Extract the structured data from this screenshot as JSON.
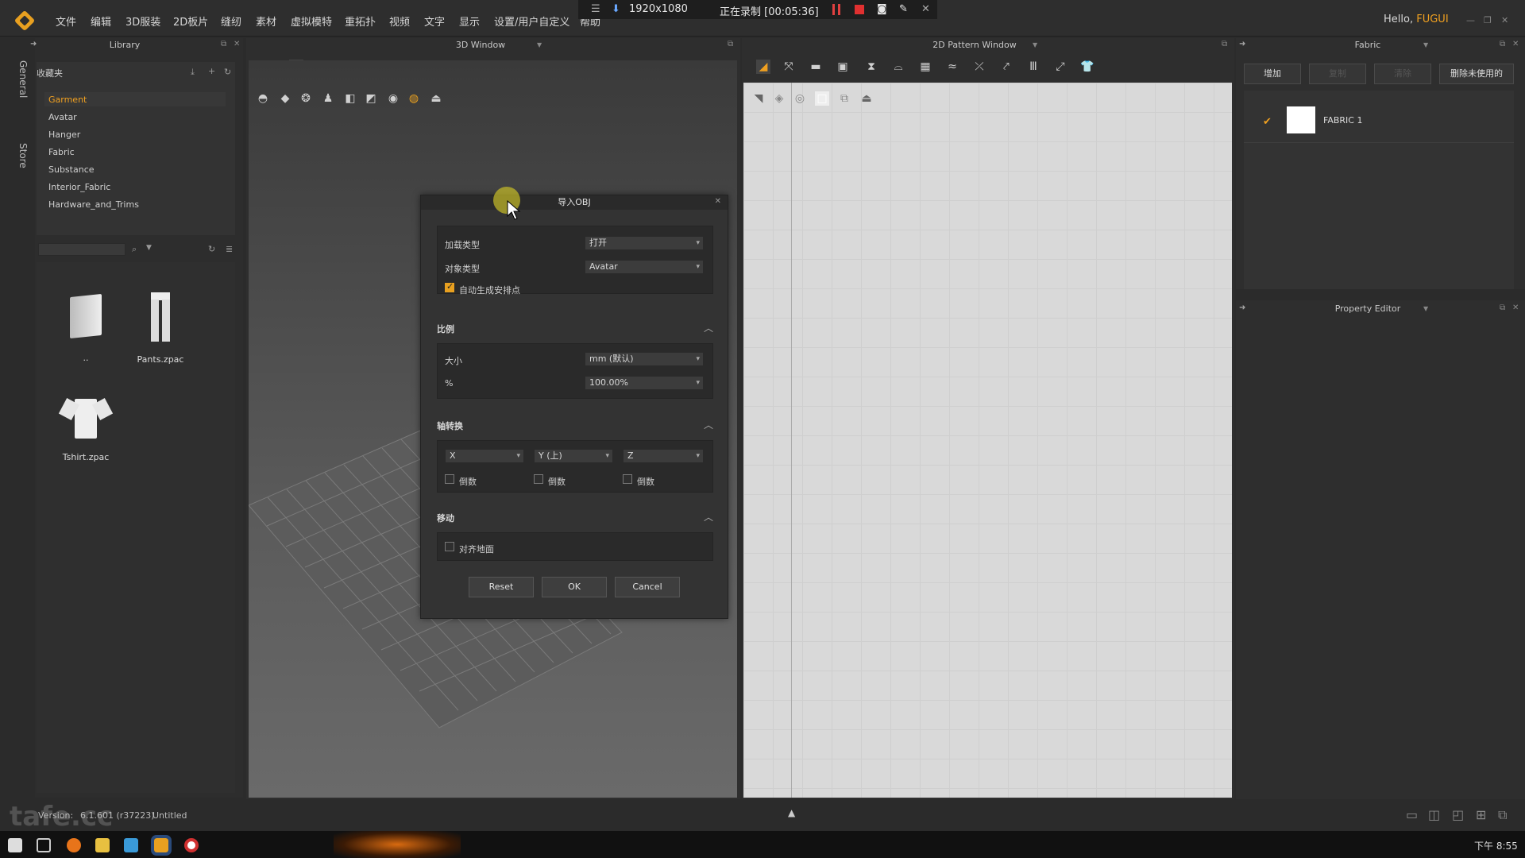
{
  "menubar": {
    "items": [
      "文件",
      "编辑",
      "3D服装",
      "2D板片",
      "缝纫",
      "素材",
      "虚拟模特",
      "重拓扑",
      "视频",
      "文字",
      "显示",
      "设置/用户自定义",
      "帮助"
    ],
    "hello_prefix": "Hello,",
    "user": "FUGUI"
  },
  "recorder": {
    "resolution": "1920x1080",
    "status": "正在录制 [00:05:36]"
  },
  "library": {
    "title": "Library",
    "favorites_label": "收藏夹",
    "side_tabs": [
      "General",
      "Store"
    ],
    "items": [
      "Garment",
      "Avatar",
      "Hanger",
      "Fabric",
      "Substance",
      "Interior_Fabric",
      "Hardware_and_Trims"
    ],
    "thumbnails": [
      "..",
      "Pants.zpac",
      "Tshirt.zpac"
    ]
  },
  "window3d": {
    "title": "3D Window"
  },
  "window2d": {
    "title": "2D Pattern Window"
  },
  "fabric_panel": {
    "title": "Fabric",
    "buttons": [
      "增加",
      "复制",
      "清除",
      "删除未使用的"
    ],
    "items": [
      {
        "name": "FABRIC 1",
        "color": "#ffffff"
      }
    ]
  },
  "property_editor": {
    "title": "Property Editor"
  },
  "dialog": {
    "title": "导入OBJ",
    "load_type_label": "加载类型",
    "load_type_value": "打开",
    "object_type_label": "对象类型",
    "object_type_value": "Avatar",
    "auto_arrange_label": "自动生成安排点",
    "auto_arrange_checked": true,
    "scale_section": "比例",
    "size_label": "大小",
    "size_value": "mm (默认)",
    "percent_label": "%",
    "percent_value": "100.00%",
    "axis_section": "轴转换",
    "axis_x": "X",
    "axis_y": "Y (上)",
    "axis_z": "Z",
    "invert_label": "倒数",
    "move_section": "移动",
    "align_ground_label": "对齐地面",
    "buttons": {
      "reset": "Reset",
      "ok": "OK",
      "cancel": "Cancel"
    }
  },
  "status": {
    "version_label": "Version:",
    "version": "6.1.601 (r37223)",
    "file": "Untitled"
  },
  "taskbar": {
    "clock": "下午 8:55"
  },
  "watermark": "tafe.cc",
  "colors": {
    "accent": "#f0a020",
    "record": "#e03030"
  }
}
